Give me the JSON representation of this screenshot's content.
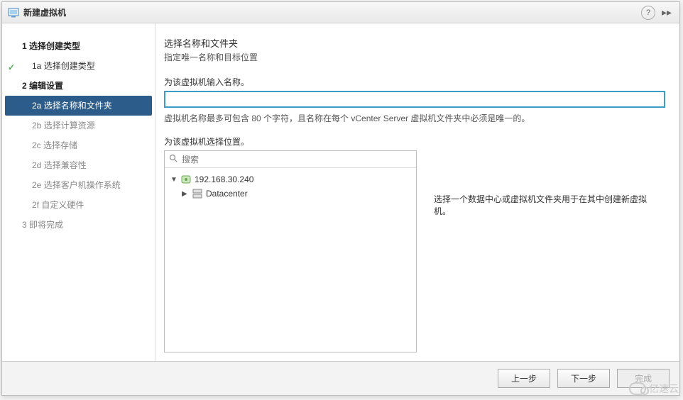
{
  "dialog": {
    "title": "新建虚拟机"
  },
  "sidebar": {
    "steps": [
      {
        "num": "1",
        "label": "选择创建类型"
      },
      {
        "num": "1a",
        "label": "选择创建类型"
      },
      {
        "num": "2",
        "label": "编辑设置"
      },
      {
        "num": "2a",
        "label": "选择名称和文件夹"
      },
      {
        "num": "2b",
        "label": "选择计算资源"
      },
      {
        "num": "2c",
        "label": "选择存储"
      },
      {
        "num": "2d",
        "label": "选择兼容性"
      },
      {
        "num": "2e",
        "label": "选择客户机操作系统"
      },
      {
        "num": "2f",
        "label": "自定义硬件"
      },
      {
        "num": "3",
        "label": "即将完成"
      }
    ]
  },
  "content": {
    "heading": "选择名称和文件夹",
    "subtitle": "指定唯一名称和目标位置",
    "name_label": "为该虚拟机输入名称。",
    "name_value": "",
    "name_hint": "虚拟机名称最多可包含 80 个字符，且名称在每个 vCenter Server 虚拟机文件夹中必须是唯一的。",
    "location_label": "为该虚拟机选择位置。",
    "search_placeholder": "搜索",
    "tree": {
      "root": {
        "label": "192.168.30.240"
      },
      "child": {
        "label": "Datacenter"
      }
    },
    "info_text": "选择一个数据中心或虚拟机文件夹用于在其中创建新虚拟机。"
  },
  "footer": {
    "back": "上一步",
    "next": "下一步",
    "finish": "完成"
  },
  "watermark": "亿速云"
}
